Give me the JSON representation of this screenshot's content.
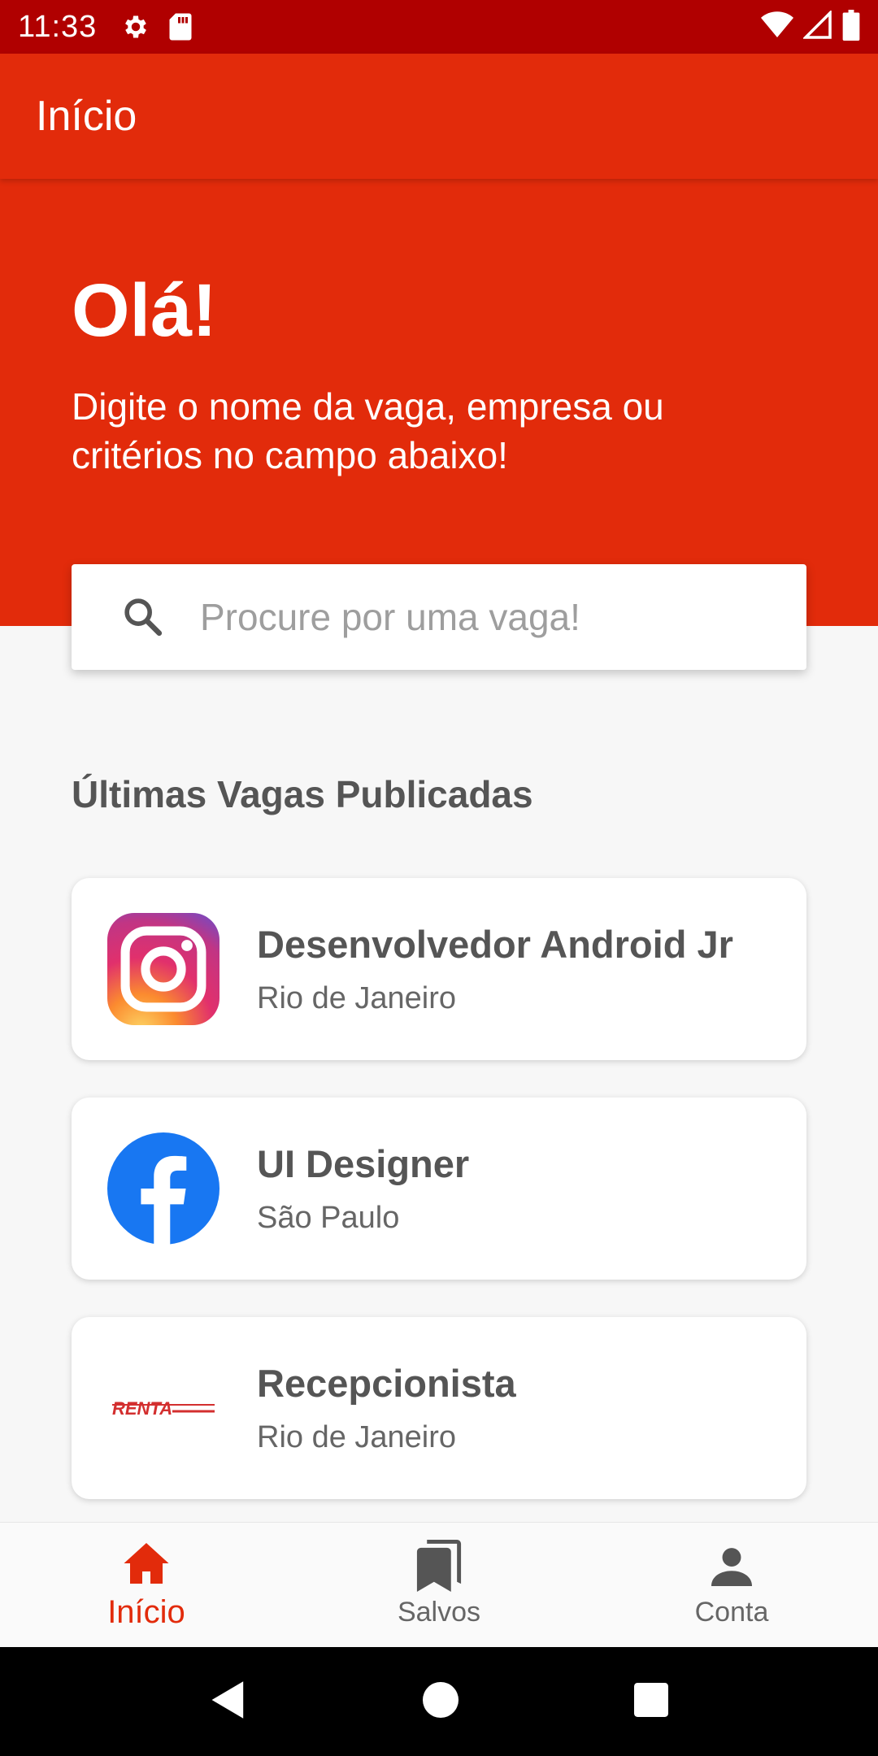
{
  "status_bar": {
    "time": "11:33",
    "icons": [
      "gear-icon",
      "sd-card-icon",
      "wifi-icon",
      "signal-icon",
      "battery-icon"
    ]
  },
  "app_bar": {
    "title": "Início"
  },
  "hero": {
    "greeting": "Olá!",
    "subtitle": "Digite o nome da vaga, empresa ou critérios no campo abaixo!"
  },
  "search": {
    "placeholder": "Procure por uma vaga!",
    "value": ""
  },
  "section": {
    "title": "Últimas Vagas Publicadas"
  },
  "jobs": [
    {
      "title": "Desenvolvedor Android Jr",
      "location": "Rio de Janeiro",
      "logo": "instagram-logo"
    },
    {
      "title": "UI Designer",
      "location": "São Paulo",
      "logo": "facebook-logo"
    },
    {
      "title": "Recepcionista",
      "location": "Rio de Janeiro",
      "logo": "renta-logo",
      "logo_text": "RENTA"
    }
  ],
  "bottom_nav": [
    {
      "label": "Início",
      "icon": "home-icon",
      "active": true
    },
    {
      "label": "Salvos",
      "icon": "bookmarks-icon",
      "active": false
    },
    {
      "label": "Conta",
      "icon": "person-icon",
      "active": false
    }
  ],
  "colors": {
    "primary": "#e22b0b",
    "status_bar": "#b00000",
    "background": "#f7f7f7"
  }
}
